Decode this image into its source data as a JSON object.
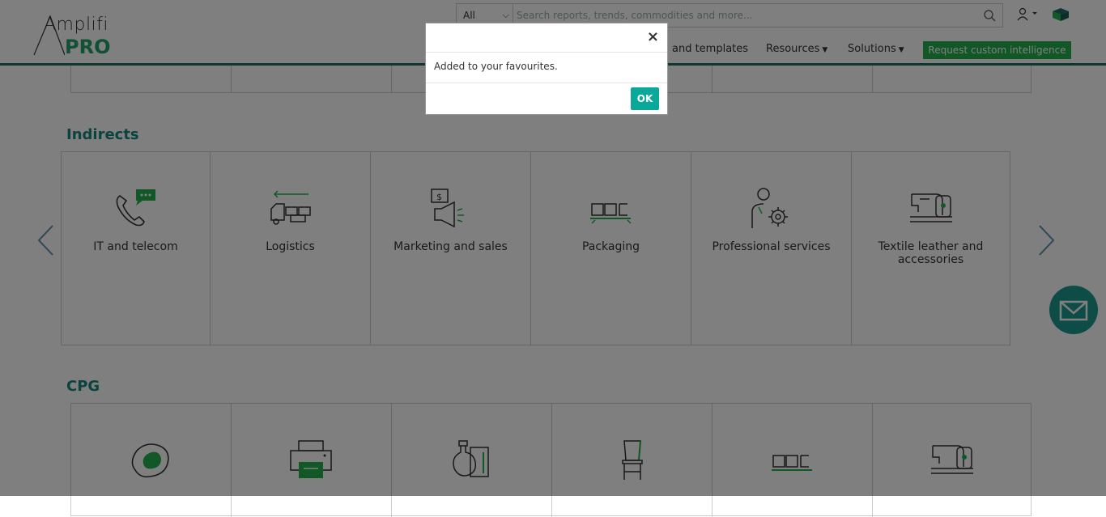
{
  "header": {
    "logo_top": "Amplifi",
    "logo_bottom": "PRO",
    "search": {
      "category": "All",
      "placeholder": "Search reports, trends, commodities and more..."
    },
    "nav": [
      {
        "label": "and templates",
        "caret": false
      },
      {
        "label": "Resources",
        "caret": true
      },
      {
        "label": "Solutions",
        "caret": true
      }
    ],
    "cta_label": "Request custom intelligence"
  },
  "sections": {
    "indirects": {
      "title": "Indirects",
      "tiles": [
        {
          "label": "IT and telecom",
          "icon": "phone-chat-icon"
        },
        {
          "label": "Logistics",
          "icon": "truck-icon"
        },
        {
          "label": "Marketing and sales",
          "icon": "megaphone-icon"
        },
        {
          "label": "Packaging",
          "icon": "boxes-icon"
        },
        {
          "label": "Professional services",
          "icon": "person-gear-icon"
        },
        {
          "label": "Textile leather and accessories",
          "icon": "sewing-machine-icon"
        }
      ]
    },
    "cpg": {
      "title": "CPG",
      "tiles": [
        {
          "label": "",
          "icon": "meat-icon"
        },
        {
          "label": "",
          "icon": "printer-icon"
        },
        {
          "label": "",
          "icon": "chemicals-icon"
        },
        {
          "label": "",
          "icon": "chair-icon"
        },
        {
          "label": "",
          "icon": "boxes-icon"
        },
        {
          "label": "",
          "icon": "sewing-machine-icon"
        }
      ]
    }
  },
  "modal": {
    "close": "×",
    "message": "Added to your favourites.",
    "ok_label": "OK"
  },
  "colors": {
    "teal": "#17867e",
    "green": "#22b14c",
    "button_teal": "#0aa89a"
  }
}
